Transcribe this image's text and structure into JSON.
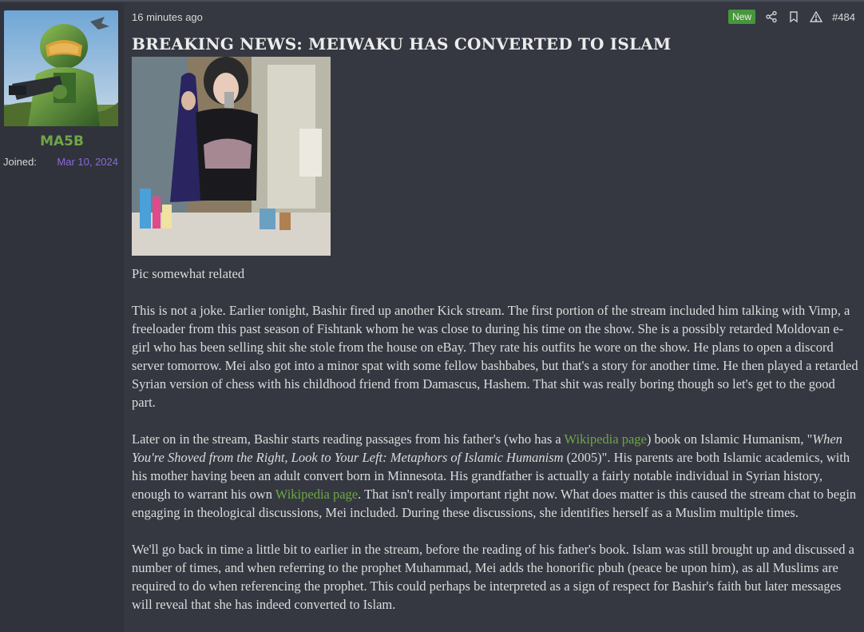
{
  "user": {
    "name": "MA5B",
    "joined_label": "Joined:",
    "joined_date": "Mar 10, 2024"
  },
  "post": {
    "timestamp": "16 minutes ago",
    "badge": "New",
    "post_number": "#484",
    "title": "BREAKING NEWS: MEIWAKU HAS CONVERTED TO ISLAM",
    "caption": "Pic somewhat related",
    "p1": "This is not a joke. Earlier tonight, Bashir fired up another Kick stream. The first portion of the stream included him talking with Vimp, a freeloader from this past season of Fishtank whom he was close to during his time on the show. She is a possibly retarded Moldovan e-girl who has been selling shit she stole from the house on eBay. They rate his outfits he wore on the show. He plans to open a discord server tomorrow. Mei also got into a minor spat with some fellow bashbabes, but that's a story for another time. He then played a retarded Syrian version of chess with his childhood friend from Damascus, Hashem. That shit was really boring though so let's get to the good part.",
    "p2": {
      "a": "Later on in the stream, Bashir starts reading passages from his father's (who has a ",
      "link1": "Wikipedia page",
      "b": ") book on Islamic Humanism, \"",
      "book": "When You're Shoved from the Right, Look to Your Left: Metaphors of Islamic Humanism",
      "c": " (2005)\". His parents are both Islamic academics, with his mother having been an adult convert born in Minnesota. His grandfather is actually a fairly notable individual in Syrian history, enough to warrant his own ",
      "link2": "Wikipedia page",
      "d": ". That isn't really important right now. What does matter is this caused the stream chat to begin engaging in theological discussions, Mei included. During these discussions, she identifies herself as a Muslim multiple times."
    },
    "p3": "We'll go back in time a little bit to earlier in the stream, before the reading of his father's book. Islam was still brought up and discussed a number of times, and when referring to the prophet Muhammad, Mei adds the honorific pbuh (peace be upon him), as all Muslims are required to do when referencing the prophet. This could perhaps be interpreted as a sign of respect for Bashir's faith but later messages will reveal that she has indeed converted to Islam."
  },
  "colors": {
    "accent_green": "#6ea646",
    "badge_green": "#47963b",
    "date_purple": "#8a6ad8",
    "background": "#353841"
  },
  "icons": [
    "share-icon",
    "bookmark-icon",
    "report-icon"
  ]
}
